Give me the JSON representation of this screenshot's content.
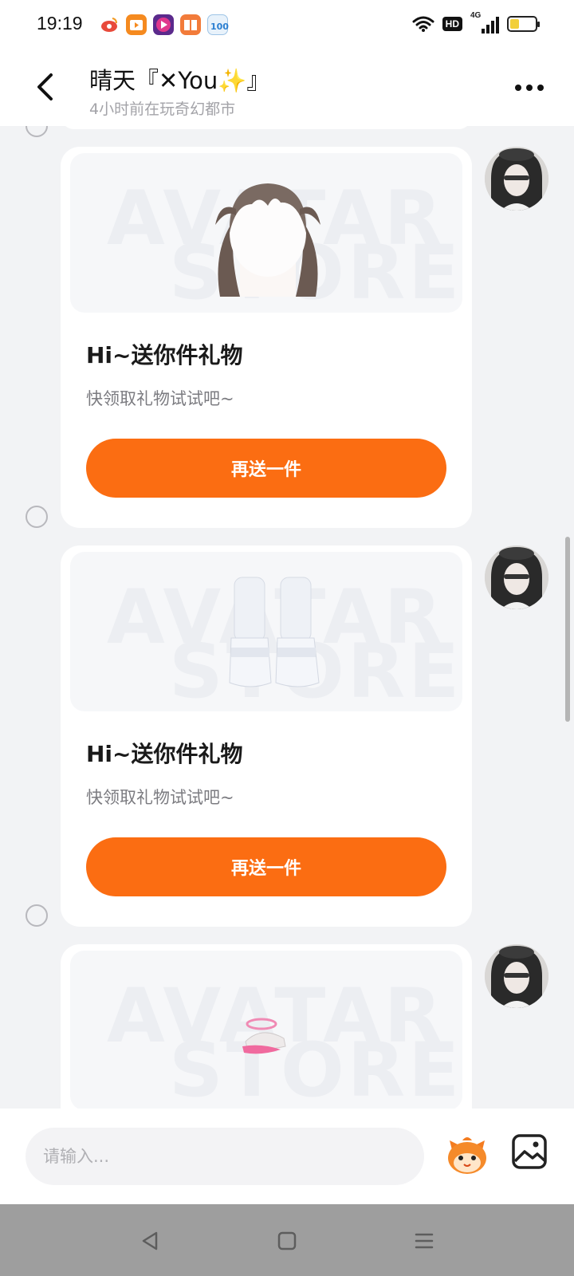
{
  "status_bar": {
    "time": "19:19",
    "hd": "HD",
    "network": "4G",
    "battery_level": 0.35
  },
  "header": {
    "title": "晴天『✕You✨』",
    "subtitle": "4小时前在玩奇幻都市"
  },
  "watermark": {
    "line1": "AVATAR",
    "line2": "STORE"
  },
  "messages": [
    {
      "title": "Hi~送你件礼物",
      "desc": "快领取礼物试试吧~",
      "button": "再送一件",
      "item": "hair-item"
    },
    {
      "title": "Hi~送你件礼物",
      "desc": "快领取礼物试试吧~",
      "button": "再送一件",
      "item": "boots-item"
    },
    {
      "item": "hat-item"
    }
  ],
  "input": {
    "placeholder": "请输入..."
  },
  "colors": {
    "accent": "#fb6d12",
    "background": "#f2f3f5",
    "nav_bar": "#9e9e9e"
  }
}
